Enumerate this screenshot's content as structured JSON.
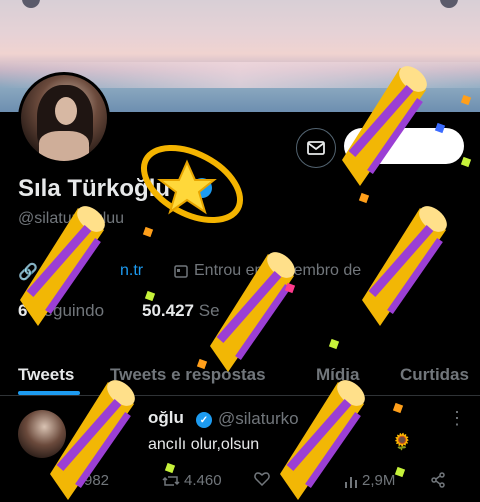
{
  "profile": {
    "name": "Sıla Türkoğlu",
    "verified_symbol": "✓",
    "handle": "@silaturkogluu",
    "link_text": "n.tr",
    "joined_text": "Entrou em setembro de",
    "following_count": "6",
    "following_label": "Seguindo",
    "followers_count": "50.427",
    "followers_label": "Se"
  },
  "tabs": [
    {
      "label": "Tweets"
    },
    {
      "label": "Tweets e respostas"
    },
    {
      "label": "Mídia"
    },
    {
      "label": "Curtidas"
    }
  ],
  "tweet": {
    "name": "oğlu",
    "handle": "@silaturko",
    "text": "ancılı olur,olsun",
    "emoji": "🌻",
    "more": "⋮",
    "replies": "982",
    "retweets": "4.460",
    "views": "2,9M"
  },
  "icons": {
    "message": "mail-icon",
    "calendar": "calendar-icon",
    "link": "link-icon",
    "reply": "reply-icon",
    "retweet": "retweet-icon",
    "like": "like-icon",
    "views": "views-icon",
    "share": "share-icon"
  },
  "colors": {
    "accent": "#1d9bf0",
    "background": "#000000",
    "muted": "#71767b",
    "text": "#e7e9ea"
  }
}
